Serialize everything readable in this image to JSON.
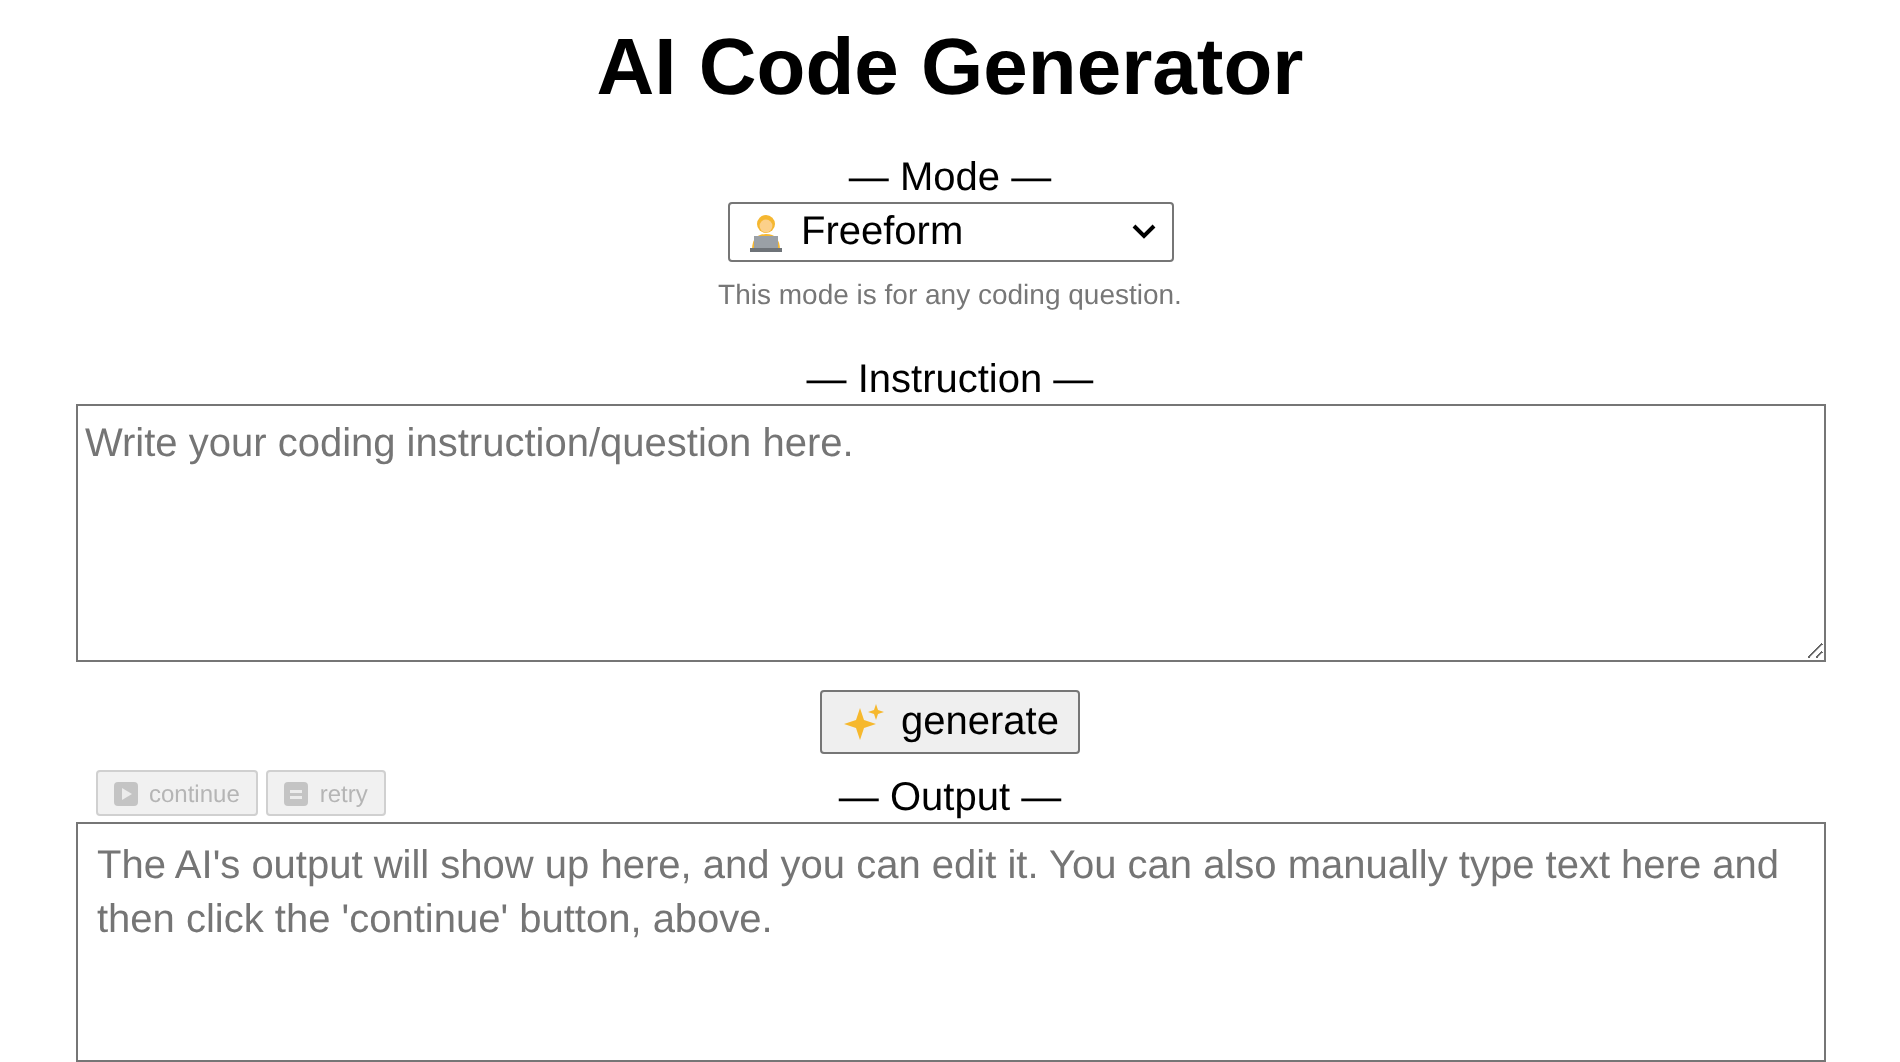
{
  "title": "AI Code Generator",
  "mode": {
    "label": "— Mode —",
    "value": "Freeform",
    "hint": "This mode is for any coding question."
  },
  "instruction": {
    "label": "— Instruction —",
    "placeholder": "Write your coding instruction/question here."
  },
  "generate_button": {
    "label": "generate"
  },
  "output": {
    "label": "— Output —",
    "placeholder": "The AI's output will show up here, and you can edit it. You can also manually type text here and then click the 'continue' button, above.",
    "actions": [
      {
        "kind": "continue",
        "label": "continue",
        "disabled": true
      },
      {
        "kind": "retry",
        "label": "retry",
        "disabled": true
      }
    ]
  }
}
